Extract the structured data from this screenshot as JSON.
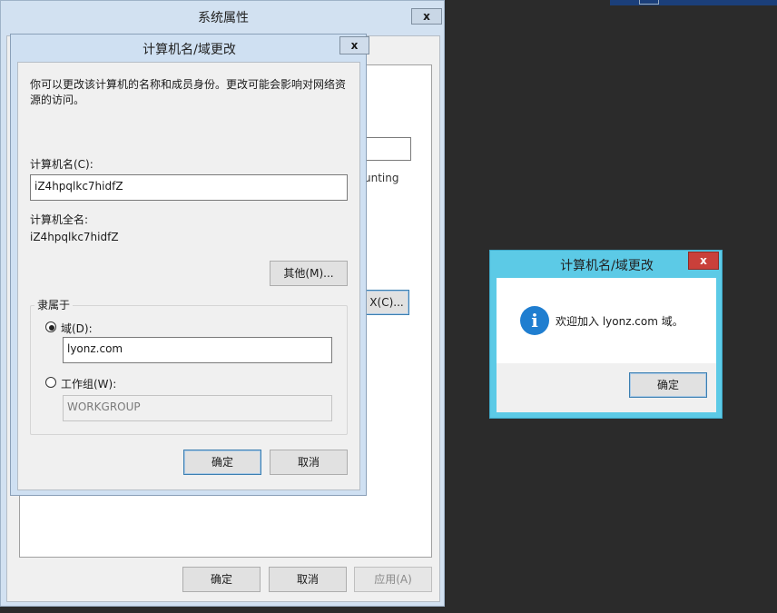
{
  "system_properties": {
    "title": "系统属性",
    "close_label": "x",
    "peek_text": "unting",
    "peek_button_label": "X(C)...",
    "ok_label": "确定",
    "cancel_label": "取消",
    "apply_label": "应用(A)"
  },
  "computer_name_dialog": {
    "title": "计算机名/域更改",
    "close_label": "x",
    "description": "你可以更改该计算机的名称和成员身份。更改可能会影响对网络资源的访问。",
    "description_line1": "你可以更改该计算机的名称和成员身份。更改可能会影响对网络资",
    "description_line2": "源的访问。",
    "computer_name_label": "计算机名(C):",
    "computer_name_value": "iZ4hpqlkc7hidfZ",
    "full_name_label": "计算机全名:",
    "full_name_value": "iZ4hpqlkc7hidfZ",
    "more_button_label": "其他(M)...",
    "member_of_label": "隶属于",
    "domain_option_label": "域(D):",
    "domain_value": "lyonz.com",
    "domain_selected": true,
    "workgroup_option_label": "工作组(W):",
    "workgroup_value": "WORKGROUP",
    "ok_label": "确定",
    "cancel_label": "取消"
  },
  "welcome_dialog": {
    "title": "计算机名/域更改",
    "close_label": "x",
    "message": "欢迎加入 lyonz.com 域。",
    "ok_label": "确定",
    "icon": "info-icon"
  },
  "colors": {
    "desktop": "#2b2b2b",
    "dialog_frame": "#cfe0f2",
    "message_frame": "#5ccae6",
    "close_red": "#c9403a",
    "info_blue": "#1f7ed0"
  }
}
